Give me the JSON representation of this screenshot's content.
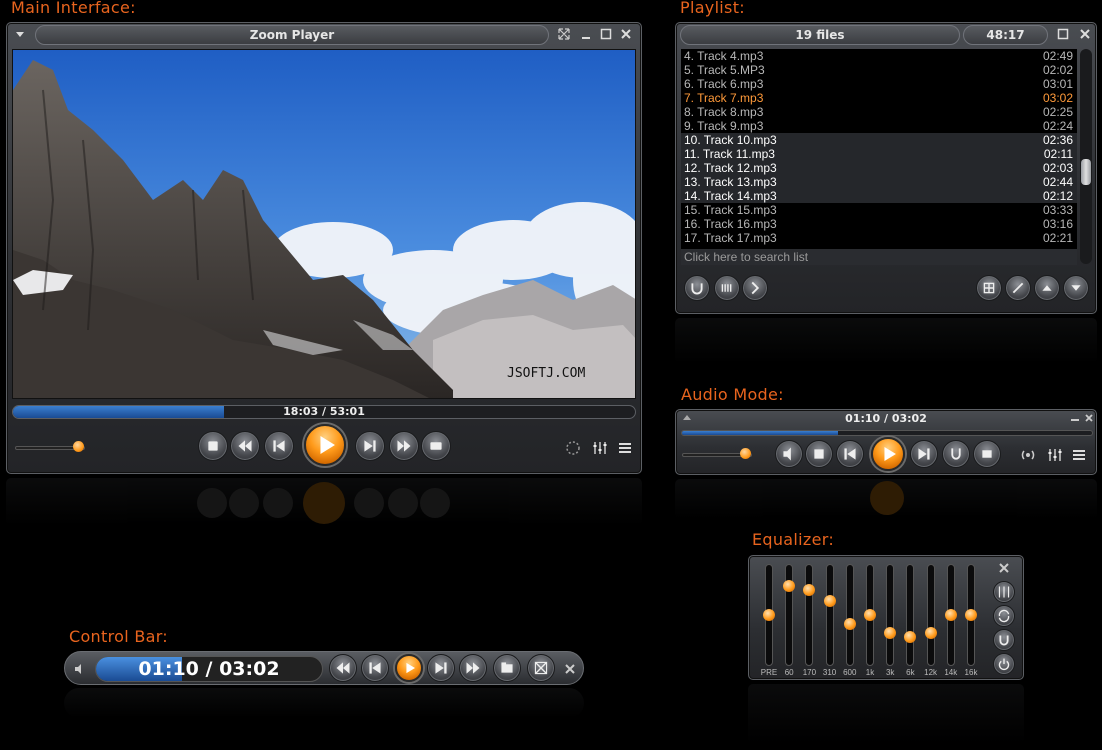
{
  "sections": {
    "main": "Main Interface:",
    "playlist": "Playlist:",
    "audio": "Audio Mode:",
    "equalizer": "Equalizer:",
    "control_bar": "Control Bar:"
  },
  "main_window": {
    "title": "Zoom Player",
    "watermark": "JSOFTJ.COM",
    "seek_text": "18:03 / 53:01",
    "seek_progress": 0.34,
    "volume_level": 0.9,
    "icons": [
      "menu-arrow-icon",
      "fullscreen-icon",
      "minimize-icon",
      "maximize-icon",
      "close-icon",
      "stop-icon",
      "rewind-icon",
      "previous-icon",
      "play-icon",
      "next-icon",
      "fast-forward-icon",
      "eject-icon",
      "dial-icon",
      "equalizer-icon",
      "list-icon"
    ]
  },
  "playlist": {
    "file_count": "19 files",
    "total_duration": "48:17",
    "search_placeholder": "Click here to search list",
    "items": [
      {
        "name": "4. Track 4.mp3",
        "duration": "02:49",
        "state": "normal"
      },
      {
        "name": "5. Track 5.MP3",
        "duration": "02:02",
        "state": "normal"
      },
      {
        "name": "6. Track 6.mp3",
        "duration": "03:01",
        "state": "normal"
      },
      {
        "name": "7. Track 7.mp3",
        "duration": "03:02",
        "state": "current"
      },
      {
        "name": "8. Track 8.mp3",
        "duration": "02:25",
        "state": "normal"
      },
      {
        "name": "9. Track 9.mp3",
        "duration": "02:24",
        "state": "normal"
      },
      {
        "name": "10. Track 10.mp3",
        "duration": "02:36",
        "state": "selected"
      },
      {
        "name": "11. Track 11.mp3",
        "duration": "02:11",
        "state": "selected"
      },
      {
        "name": "12. Track 12.mp3",
        "duration": "02:03",
        "state": "selected"
      },
      {
        "name": "13. Track 13.mp3",
        "duration": "02:44",
        "state": "selected"
      },
      {
        "name": "14. Track 14.mp3",
        "duration": "02:12",
        "state": "selected"
      },
      {
        "name": "15. Track 15.mp3",
        "duration": "03:33",
        "state": "normal"
      },
      {
        "name": "16. Track 16.mp3",
        "duration": "03:16",
        "state": "normal"
      },
      {
        "name": "17. Track 17.mp3",
        "duration": "02:21",
        "state": "normal"
      }
    ]
  },
  "audio_mode": {
    "time_text": "01:10 / 03:02",
    "seek_progress": 0.38,
    "volume_level": 0.9
  },
  "equalizer": {
    "bands": [
      {
        "label": "PRE",
        "level": 0.5
      },
      {
        "label": "60",
        "level": 0.82
      },
      {
        "label": "170",
        "level": 0.78
      },
      {
        "label": "310",
        "level": 0.66
      },
      {
        "label": "600",
        "level": 0.4
      },
      {
        "label": "1k",
        "level": 0.5
      },
      {
        "label": "3k",
        "level": 0.3
      },
      {
        "label": "6k",
        "level": 0.26
      },
      {
        "label": "12k",
        "level": 0.3
      },
      {
        "label": "14k",
        "level": 0.5
      },
      {
        "label": "16k",
        "level": 0.5
      }
    ]
  },
  "control_bar": {
    "time_text": "01:10 / 03:02",
    "progress": 0.38
  },
  "colors": {
    "accent_orange": "#e8641e",
    "progress_blue": "#2a66b8",
    "current_track": "#ff9a3a"
  }
}
